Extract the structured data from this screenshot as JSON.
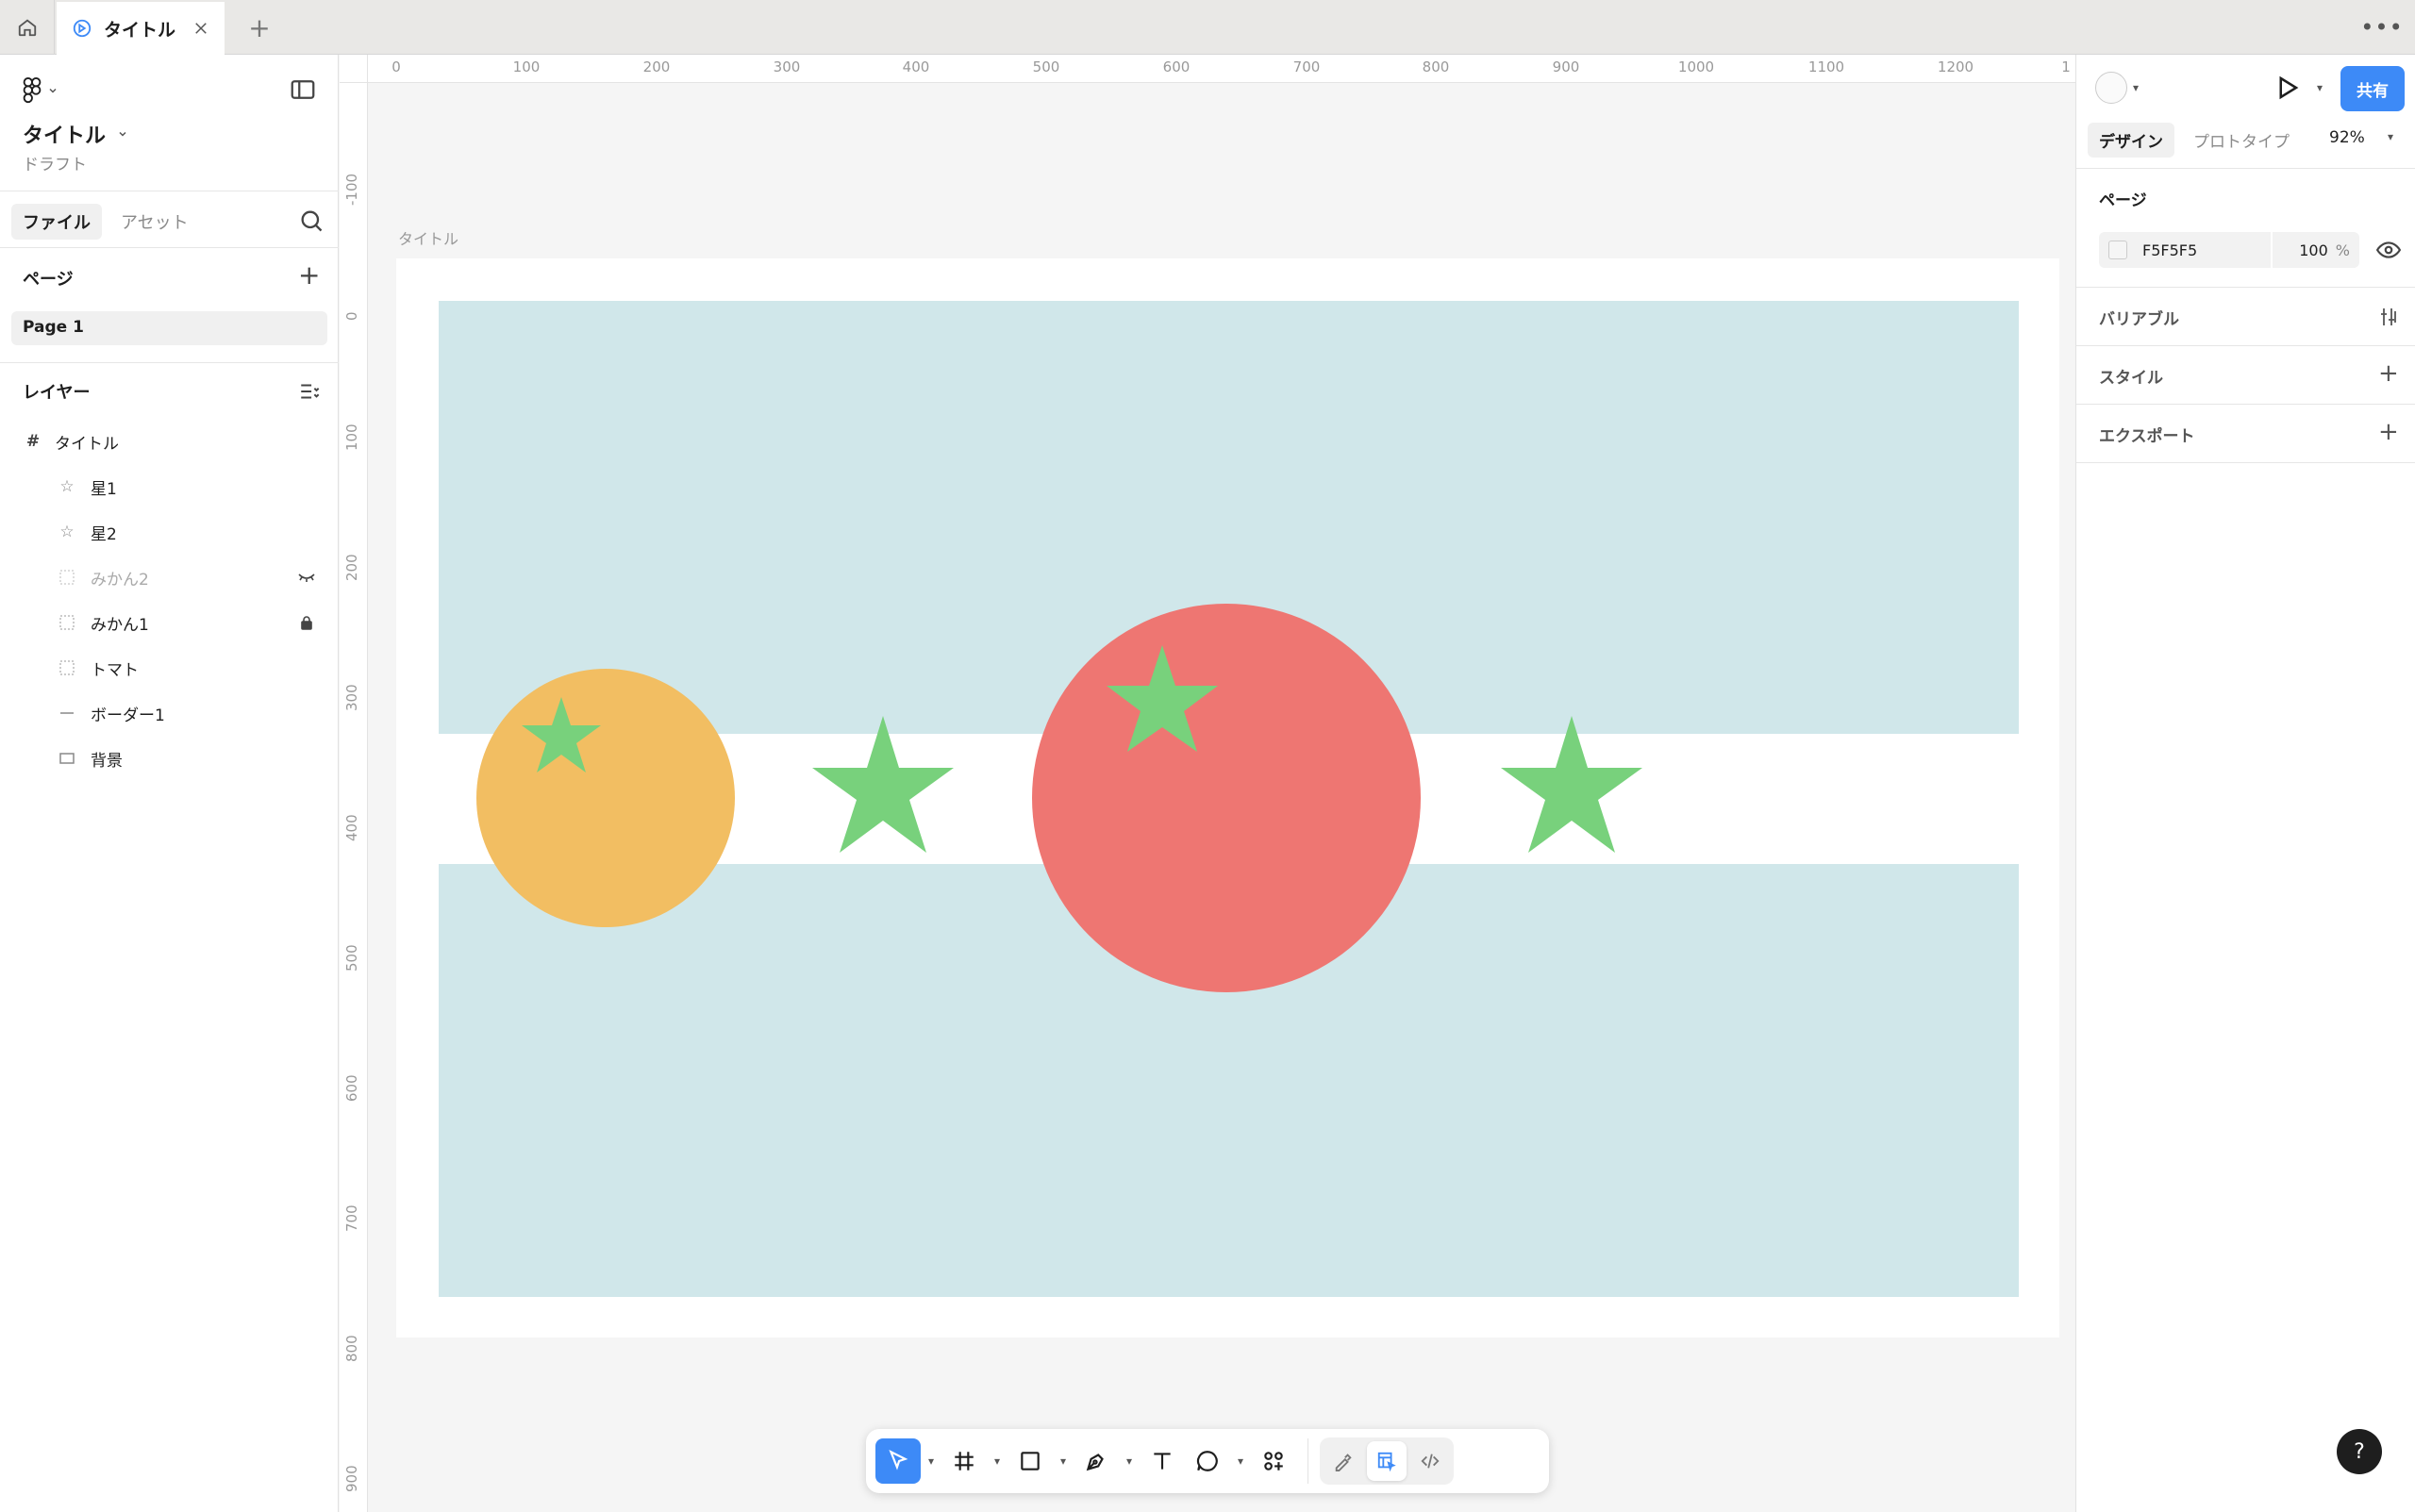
{
  "tabbar": {
    "tab_title": "タイトル"
  },
  "left_panel": {
    "file_title": "タイトル",
    "file_status": "ドラフト",
    "tabs": [
      "ファイル",
      "アセット"
    ],
    "pages_heading": "ページ",
    "page_item": "Page 1",
    "layers_heading": "レイヤー",
    "layers": [
      {
        "name": "タイトル",
        "icon": "frame-icon"
      },
      {
        "name": "星1",
        "icon": "star-icon"
      },
      {
        "name": "星2",
        "icon": "star-icon"
      },
      {
        "name": "みかん2",
        "icon": "dashed-square-icon",
        "hidden": true
      },
      {
        "name": "みかん1",
        "icon": "dashed-square-icon",
        "locked": true
      },
      {
        "name": "トマト",
        "icon": "dashed-square-icon"
      },
      {
        "name": "ボーダー1",
        "icon": "line-icon"
      },
      {
        "name": "背景",
        "icon": "rectangle-icon"
      }
    ]
  },
  "canvas": {
    "ruler_top": [
      "0",
      "100",
      "200",
      "300",
      "400",
      "500",
      "600",
      "700",
      "800",
      "900",
      "1000",
      "1100",
      "1200",
      "1"
    ],
    "ruler_left": [
      "-100",
      "0",
      "100",
      "200",
      "300",
      "400",
      "500",
      "600",
      "700",
      "800",
      "900"
    ],
    "frame_label": "タイトル",
    "colors": {
      "background_band": "#d0e7ea",
      "white_band": "#ffffff",
      "orange": "#f2be62",
      "tomato": "#ee7672",
      "star": "#78d17c"
    }
  },
  "right_panel": {
    "share_label": "共有",
    "tabs": [
      "デザイン",
      "プロトタイプ"
    ],
    "zoom": "92%",
    "page_heading": "ページ",
    "page_fill_hex": "F5F5F5",
    "page_fill_opacity": "100",
    "page_fill_pct": "%",
    "variables_heading": "バリアブル",
    "styles_heading": "スタイル",
    "export_heading": "エクスポート"
  },
  "help_label": "?"
}
